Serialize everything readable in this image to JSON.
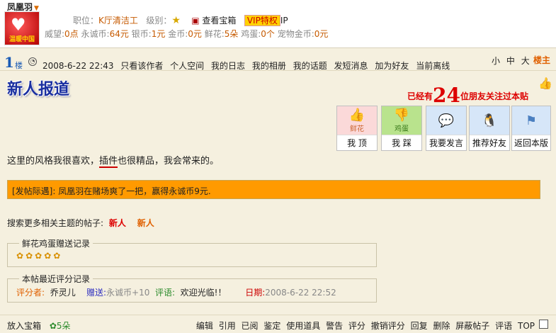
{
  "user": {
    "name": "凤凰羽",
    "avatar_caption": "温暖中国",
    "job_label": "职位：",
    "job_value": "K厅清洁工",
    "level_label": "级别：",
    "treasure_label": "查看宝箱",
    "vip_label": "VIP特权",
    "ip_label": "IP",
    "stats": [
      {
        "label": "威望:",
        "value": "0点"
      },
      {
        "label": "永诚币:",
        "value": "64元"
      },
      {
        "label": "银币:",
        "value": "1元"
      },
      {
        "label": "金币:",
        "value": "0元"
      },
      {
        "label": "鲜花:",
        "value": "5朵"
      },
      {
        "label": "鸡蛋:",
        "value": "0个"
      },
      {
        "label": "宠物金币:",
        "value": "0元"
      }
    ]
  },
  "floor": {
    "number": "1",
    "label": "楼",
    "datetime": "2008-6-22 22:43",
    "links": [
      "只看该作者",
      "个人空间",
      "我的日志",
      "我的相册",
      "我的话题",
      "发短消息",
      "加为好友",
      "当前离线"
    ],
    "font_sizes": [
      "小",
      "中",
      "大"
    ],
    "owner_label": "楼主"
  },
  "post": {
    "title": "新人报道",
    "banner_prefix": "已经有",
    "banner_count": "24",
    "banner_suffix": "位朋友关注过本贴",
    "actions": [
      {
        "icon": "flower-thumb-icon",
        "sub": "鲜花",
        "label": "我 顶"
      },
      {
        "icon": "egg-thumb-icon",
        "sub": "鸡蛋",
        "label": "我 踩"
      },
      {
        "icon": "speech-bubble-icon",
        "sub": "",
        "label": "我要发言"
      },
      {
        "icon": "qq-penguin-icon",
        "sub": "",
        "label": "推荐好友"
      },
      {
        "icon": "return-flag-icon",
        "sub": "",
        "label": "返回本版"
      }
    ],
    "content_before": "这里的风格我很喜欢，",
    "content_emph": "插件",
    "content_after": "也很精品，我会常来的。",
    "notice": "[发帖际遇]: 凤凰羽在赌场爽了一把，赢得永诚币9元.",
    "search_label": "搜索更多相关主题的帖子:",
    "search_tags": [
      "新人",
      "新人"
    ]
  },
  "flower_record": {
    "legend": "鲜花鸡蛋赠送记录",
    "flower_count": 5
  },
  "rating_record": {
    "legend": "本帖最近评分记录",
    "rater_label": "评分者:",
    "rater": "乔灵儿",
    "gift_label": "赠送:",
    "gift_value": "永诚币+10",
    "comment_label": "评语:",
    "comment": "欢迎光临!！",
    "date_label": "日期:",
    "date": "2008-6-22 22:52"
  },
  "bottom": {
    "treasure": "放入宝箱",
    "flowers": "5朵",
    "actions": [
      "编辑",
      "引用",
      "已阅",
      "鉴定",
      "使用道具",
      "警告",
      "评分",
      "撤销评分",
      "回复",
      "删除",
      "屏蔽帖子",
      "评语",
      "TOP"
    ]
  }
}
